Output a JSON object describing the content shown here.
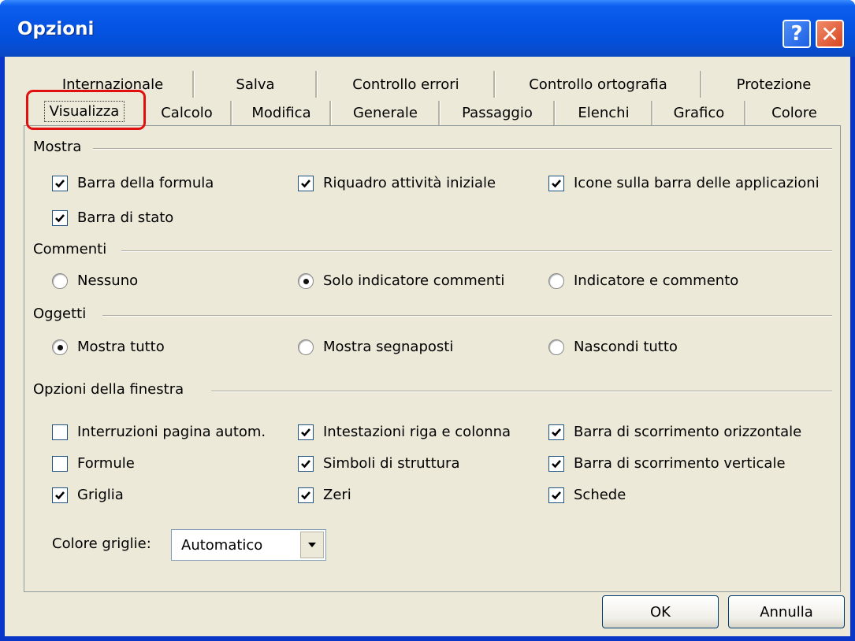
{
  "window": {
    "title": "Opzioni",
    "help_label": "?",
    "close_label": "✕"
  },
  "tabs_back": [
    "Internazionale",
    "Salva",
    "Controllo errori",
    "Controllo ortografia",
    "Protezione"
  ],
  "tabs_front": [
    "Visualizza",
    "Calcolo",
    "Modifica",
    "Generale",
    "Passaggio",
    "Elenchi",
    "Grafico",
    "Colore"
  ],
  "active_tab": "Visualizza",
  "sections": {
    "mostra": "Mostra",
    "commenti": "Commenti",
    "oggetti": "Oggetti",
    "finestra": "Opzioni della finestra"
  },
  "mostra": [
    {
      "label": "Barra della formula",
      "checked": true
    },
    {
      "label": "Riquadro attività iniziale",
      "checked": true
    },
    {
      "label": "Icone sulla barra delle applicazioni",
      "checked": true
    },
    {
      "label": "Barra di stato",
      "checked": true
    }
  ],
  "commenti": [
    {
      "label": "Nessuno",
      "selected": false
    },
    {
      "label": "Solo indicatore commenti",
      "selected": true
    },
    {
      "label": "Indicatore e commento",
      "selected": false
    }
  ],
  "oggetti": [
    {
      "label": "Mostra tutto",
      "selected": true
    },
    {
      "label": "Mostra segnaposti",
      "selected": false
    },
    {
      "label": "Nascondi tutto",
      "selected": false
    }
  ],
  "finestra": [
    {
      "label": "Interruzioni pagina autom.",
      "checked": false
    },
    {
      "label": "Intestazioni riga e colonna",
      "checked": true
    },
    {
      "label": "Barra di scorrimento orizzontale",
      "checked": true
    },
    {
      "label": "Formule",
      "checked": false
    },
    {
      "label": "Simboli di struttura",
      "checked": true
    },
    {
      "label": "Barra di scorrimento verticale",
      "checked": true
    },
    {
      "label": "Griglia",
      "checked": true
    },
    {
      "label": "Zeri",
      "checked": true
    },
    {
      "label": "Schede",
      "checked": true
    }
  ],
  "gridcolor": {
    "label": "Colore griglie:",
    "value": "Automatico"
  },
  "buttons": {
    "ok": "OK",
    "cancel": "Annulla"
  },
  "colors": {
    "titlebar": "#0654e4",
    "dialog_bg": "#ece9d8",
    "highlight": "#e01010"
  }
}
